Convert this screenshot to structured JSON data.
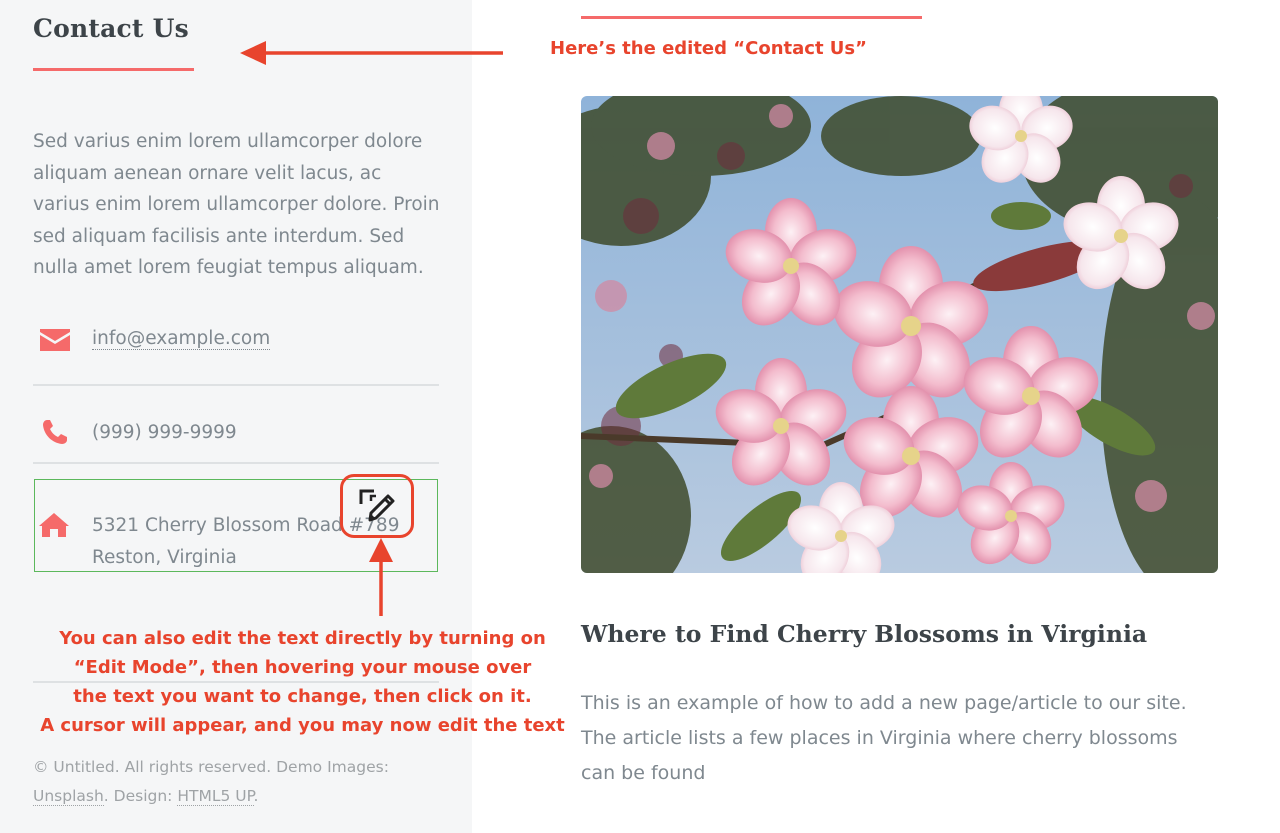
{
  "sidebar": {
    "title": "Contact Us",
    "intro": "Sed varius enim lorem ullamcorper dolore aliquam aenean ornare velit lacus, ac varius enim lorem ullamcorper dolore. Proin sed aliquam facilisis ante interdum. Sed nulla amet lorem feugiat tempus aliquam.",
    "contact": {
      "email": "info@example.com",
      "phone": "(999) 999-9999",
      "address_line1": "5321 Cherry Blossom Road #789",
      "address_line2": "Reston, Virginia",
      "email_icon": "envelope-icon",
      "phone_icon": "phone-icon",
      "address_icon": "home-icon"
    },
    "footer": {
      "copyright": "© Untitled. All rights reserved. Demo Images: ",
      "unsplash": "Unsplash",
      "design_label": ". Design: ",
      "html5up": "HTML5 UP",
      "end": "."
    }
  },
  "annotations": {
    "top": "Here’s the edited “Contact Us”",
    "bottom_line1": "You can also edit the text directly by turning on",
    "bottom_line2": "“Edit Mode”, then hovering your mouse over",
    "bottom_line3": "the text you want to change, then click on it.",
    "bottom_line4": "A cursor will appear, and you may now edit the text",
    "edit_icon": "edit-pencil-icon"
  },
  "main": {
    "image_subject": "pink cherry blossoms",
    "article_title": "Where to Find Cherry Blossoms in Virginia",
    "article_body": "This is an example of how to add a new page/article to our site. The article lists a few places in Virginia where cherry blossoms can be found"
  },
  "colors": {
    "accent": "#f56a6a",
    "annotation": "#e8442d",
    "edit_outline": "#5cb85c",
    "heading": "#3d4449",
    "body_text": "#7f888f"
  }
}
